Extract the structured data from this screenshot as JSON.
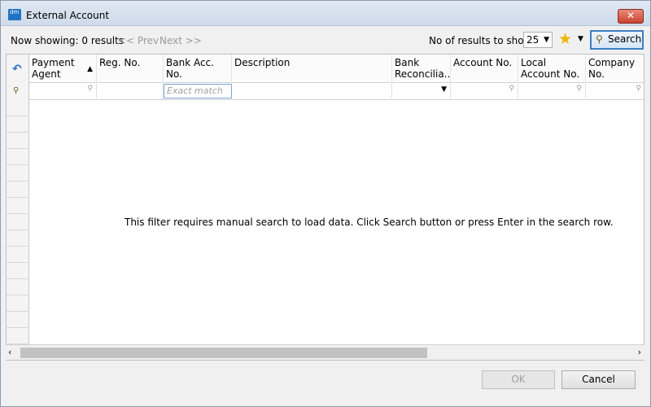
{
  "window": {
    "title": "External Account",
    "close_label": "✕"
  },
  "toolbar": {
    "now_showing": "Now showing: 0 results",
    "prev_label": "<< Prev",
    "next_label": "Next >>",
    "results_label": "No of results to show:",
    "results_value": "25",
    "search_label": "Search"
  },
  "grid": {
    "columns": [
      "Payment Agent",
      "Reg. No.",
      "Bank Acc. No.",
      "Description",
      "Bank Reconcilia...",
      "Account No.",
      "Local Account No.",
      "Company No."
    ],
    "filter_placeholder_exact": "Exact match",
    "empty_message": "This filter requires manual search to load data. Click Search button or press Enter in the search row."
  },
  "footer": {
    "ok_label": "OK",
    "cancel_label": "Cancel"
  },
  "colors": {
    "accent": "#3c7fc1",
    "star": "#f0b400",
    "close": "#c9432f"
  }
}
